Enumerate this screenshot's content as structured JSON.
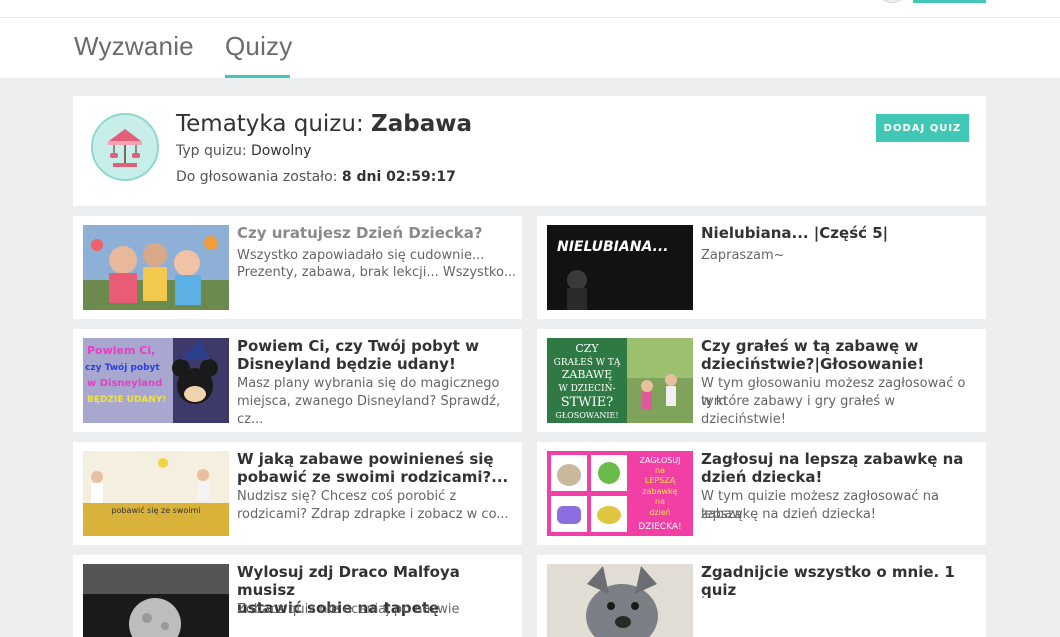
{
  "tabs": {
    "challenge": "Wyzwanie",
    "quizzes": "Quizy"
  },
  "theme": {
    "title_prefix": "Tematyka quizu: ",
    "title_value": "Zabawa",
    "type_label": "Typ quizu: ",
    "type_value": "Dowolny",
    "deadline_label": "Do głosowania zostało: ",
    "deadline_value": "8 dni 02:59:17",
    "add_button": "DODAJ QUIZ",
    "icon": "carousel-icon"
  },
  "colors": {
    "accent": "#41c7b5",
    "background": "#eceef0"
  },
  "quizzes": [
    {
      "title": "Czy uratujesz Dzień Dziecka?",
      "desc_line1": "Wszystko zapowiadało się cudownie...",
      "desc_line2": "Prezenty, zabawa, brak lekcji... Wszystko..."
    },
    {
      "title": "Nielubiana... |Część 5|",
      "desc_line1": "Zapraszam~",
      "thumb_text": "NIELUBIANA..."
    },
    {
      "title_line1": "Powiem Ci, czy Twój pobyt w",
      "title_line2": "Disneyland będzie udany!",
      "desc_line1": "Masz plany wybrania się do magicznego",
      "desc_line2": "miejsca, zwanego Disneyland? Sprawdź, cz...",
      "thumb_lines": [
        "Powiem Ci,",
        "czy Twój pobyt",
        "w Disneyland",
        "BĘDZIE UDANY!"
      ]
    },
    {
      "title_line1": "Czy grałeś w tą zabawę w",
      "title_line2": "dzieciństwie?|Głosowanie!",
      "desc_line1": "W tym głosowaniu możesz zagłosować o tym",
      "desc_line2": "w które zabawy i gry grałeś w dzieciństwie!",
      "thumb_lines": [
        "CZY",
        "GRAŁEŚ W TĄ",
        "ZABAWĘ",
        "W DZIECIŃ-",
        "STWIE?",
        "GŁOSOWANIE!"
      ]
    },
    {
      "title_line1": "W jaką zabawe powinieneś się",
      "title_line2": "pobawić ze swoimi rodzicami?...",
      "desc_line1": "Nudzisz się? Chcesz coś porobić z",
      "desc_line2": "rodzicami? Zdrap zdrapke i zobacz w co...",
      "thumb_text": "pobawić się ze swoimi"
    },
    {
      "title_line1": "Zagłosuj na lepszą zabawkę na",
      "title_line2": "dzień dziecka!",
      "desc_line1": "W tym quizie możesz zagłosować na lepszą",
      "desc_line2": "zabawkę na dzień dziecka!",
      "thumb_lines": [
        "ZAGŁOSUJ",
        "na",
        "LEPSZĄ",
        "zabawkę",
        "na",
        "dzień",
        "DZIECKA!"
      ]
    },
    {
      "title_line1": "Wylosuj zdj Draco Malfoya musisz",
      "title_line2": "ustawić sobie na tapetę",
      "desc_line1": "Zobacz quiz nie oceniaj po nazwie"
    },
    {
      "title": "Zgadnijcie wszystko o mnie. 1 quiz",
      "desc_line1": "."
    }
  ]
}
